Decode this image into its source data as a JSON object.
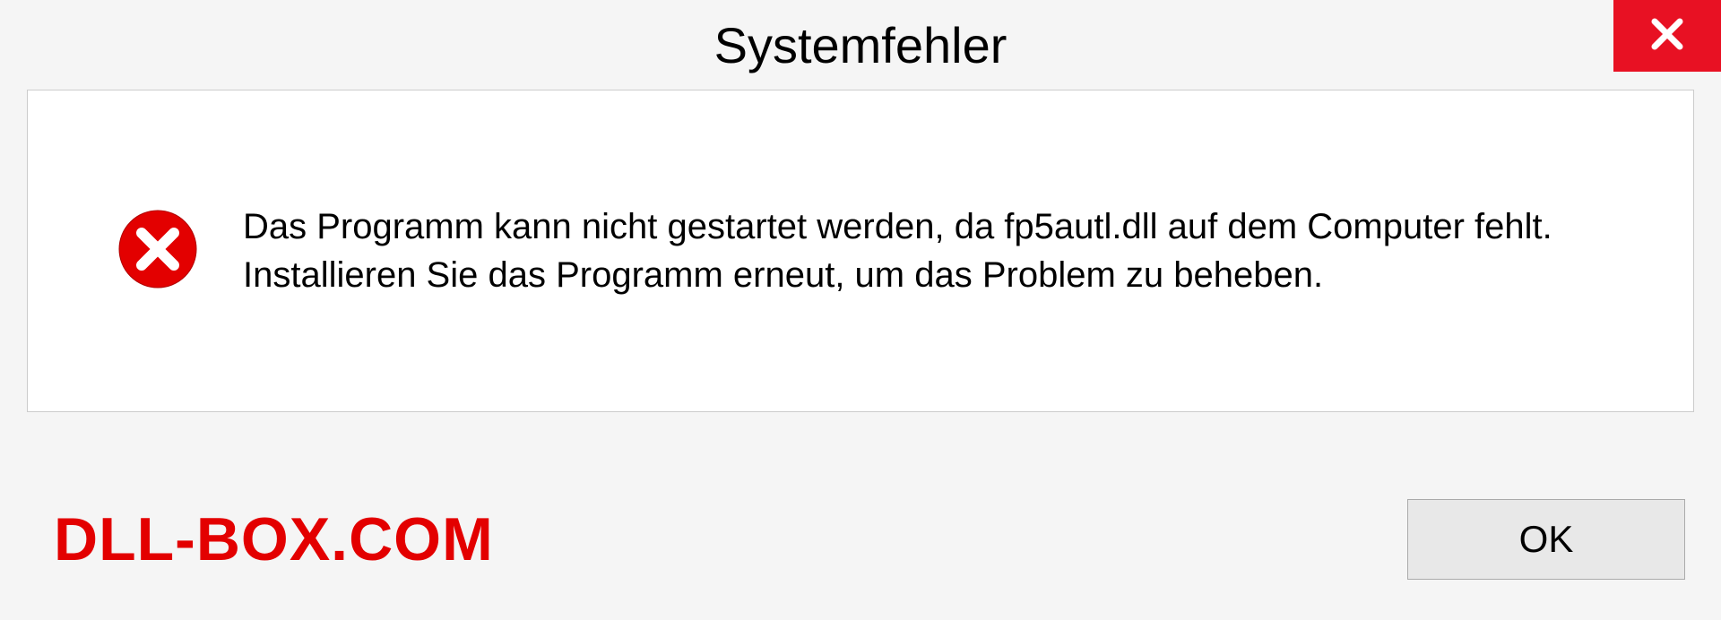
{
  "dialog": {
    "title": "Systemfehler",
    "message": "Das Programm kann nicht gestartet werden, da fp5autl.dll auf dem Computer fehlt. Installieren Sie das Programm erneut, um das Problem zu beheben.",
    "ok_label": "OK"
  },
  "watermark": "DLL-BOX.COM",
  "colors": {
    "close_bg": "#e81123",
    "error_icon": "#e30000",
    "watermark": "#e30000"
  }
}
